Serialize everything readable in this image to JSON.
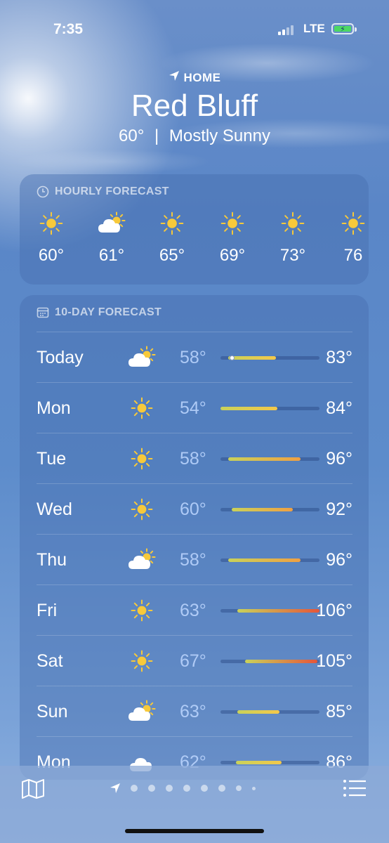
{
  "status_bar": {
    "time": "7:35",
    "network": "LTE",
    "battery_icon": "battery-charging-icon"
  },
  "header": {
    "location_label": "HOME",
    "city": "Red Bluff",
    "current_temp": "60°",
    "separator": "|",
    "condition": "Mostly Sunny"
  },
  "hourly": {
    "title": "HOURLY FORECAST",
    "items": [
      {
        "icon": "sun-icon",
        "temp": "60°"
      },
      {
        "icon": "partly-cloudy-icon",
        "temp": "61°"
      },
      {
        "icon": "sun-icon",
        "temp": "65°"
      },
      {
        "icon": "sun-icon",
        "temp": "69°"
      },
      {
        "icon": "sun-icon",
        "temp": "73°"
      },
      {
        "icon": "sun-icon",
        "temp": "76"
      }
    ]
  },
  "ten_day": {
    "title": "10-DAY FORECAST",
    "days": [
      {
        "day": "Today",
        "icon": "partly-cloudy-icon",
        "low": "58°",
        "high": "83°"
      },
      {
        "day": "Mon",
        "icon": "sun-icon",
        "low": "54°",
        "high": "84°"
      },
      {
        "day": "Tue",
        "icon": "sun-icon",
        "low": "58°",
        "high": "96°"
      },
      {
        "day": "Wed",
        "icon": "sun-icon",
        "low": "60°",
        "high": "92°"
      },
      {
        "day": "Thu",
        "icon": "partly-cloudy-icon",
        "low": "58°",
        "high": "96°"
      },
      {
        "day": "Fri",
        "icon": "sun-icon",
        "low": "63°",
        "high": "106°"
      },
      {
        "day": "Sat",
        "icon": "sun-icon",
        "low": "67°",
        "high": "105°"
      },
      {
        "day": "Sun",
        "icon": "partly-cloudy-icon",
        "low": "63°",
        "high": "85°"
      },
      {
        "day": "Mon",
        "icon": "cloud-icon",
        "low": "62°",
        "high": "86°"
      }
    ],
    "range_min": 54,
    "range_max": 106,
    "current_temp_value": 60
  },
  "bottom_bar": {
    "map_icon": "map-icon",
    "list_icon": "list-icon",
    "page_count": 9,
    "active_page": 0
  },
  "colors": {
    "sun": "#f7c93a",
    "cloud": "#ffffff",
    "bar_cool": "#c9d25a",
    "bar_warm": "#f0a042",
    "bar_hot": "#e5553a"
  }
}
